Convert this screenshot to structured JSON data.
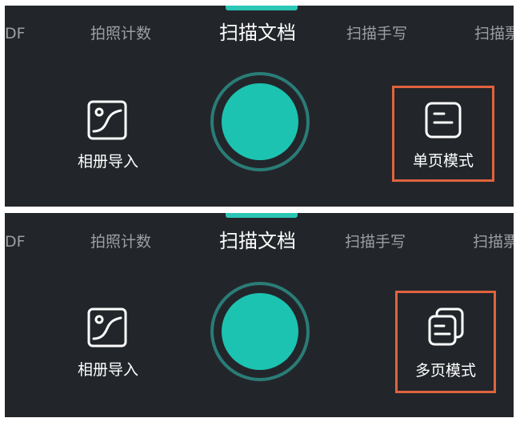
{
  "panels": [
    {
      "tabs": [
        "DF",
        "拍照计数",
        "扫描文档",
        "扫描手写",
        "扫描票"
      ],
      "active_tab": "扫描文档",
      "album_label": "相册导入",
      "mode_label": "单页模式",
      "mode_icon": "single-page-icon"
    },
    {
      "tabs": [
        "DF",
        "拍照计数",
        "扫描文档",
        "扫描手写",
        "扫描票"
      ],
      "active_tab": "扫描文档",
      "album_label": "相册导入",
      "mode_label": "多页模式",
      "mode_icon": "multi-page-icon"
    }
  ],
  "colors": {
    "background": "#22262a",
    "accent": "#1cc3b1",
    "highlight_box": "#e1633e",
    "inactive_tab": "#9b9fa3"
  }
}
